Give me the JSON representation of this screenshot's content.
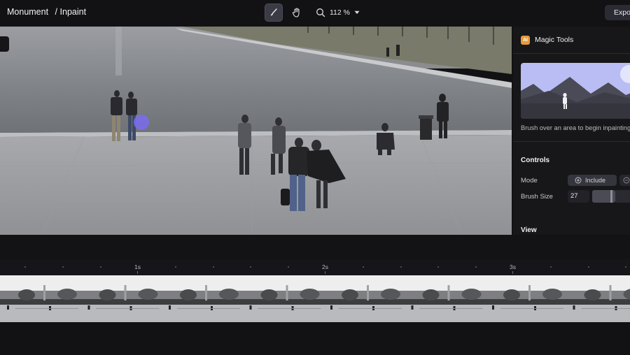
{
  "header": {
    "project": "Monument",
    "separator": "/",
    "page": "Inpaint",
    "zoom_value": "112 %",
    "export_label": "Expo"
  },
  "toolbar": {
    "tools": [
      {
        "name": "brush-icon",
        "active": true
      },
      {
        "name": "hand-icon",
        "active": false
      }
    ],
    "zoom_icon": "magnifier-icon",
    "zoom_dropdown_icon": "caret-down-icon"
  },
  "panel": {
    "badge": "AI",
    "title": "Magic Tools",
    "hint": "Brush over an area to begin inpainting",
    "controls_heading": "Controls",
    "mode_label": "Mode",
    "mode_value": "Include",
    "brush_size_label": "Brush Size",
    "brush_size_value": "27",
    "view_heading": "View"
  },
  "timeline": {
    "seconds": [
      "1s",
      "2s",
      "3s"
    ],
    "frame_count": 8
  },
  "colors": {
    "background": "#121214",
    "panel": "#17171a",
    "accent": "#e79a3b",
    "brush_cursor": "#7a6cf0",
    "illustration_sky": "#b9bdf4"
  }
}
